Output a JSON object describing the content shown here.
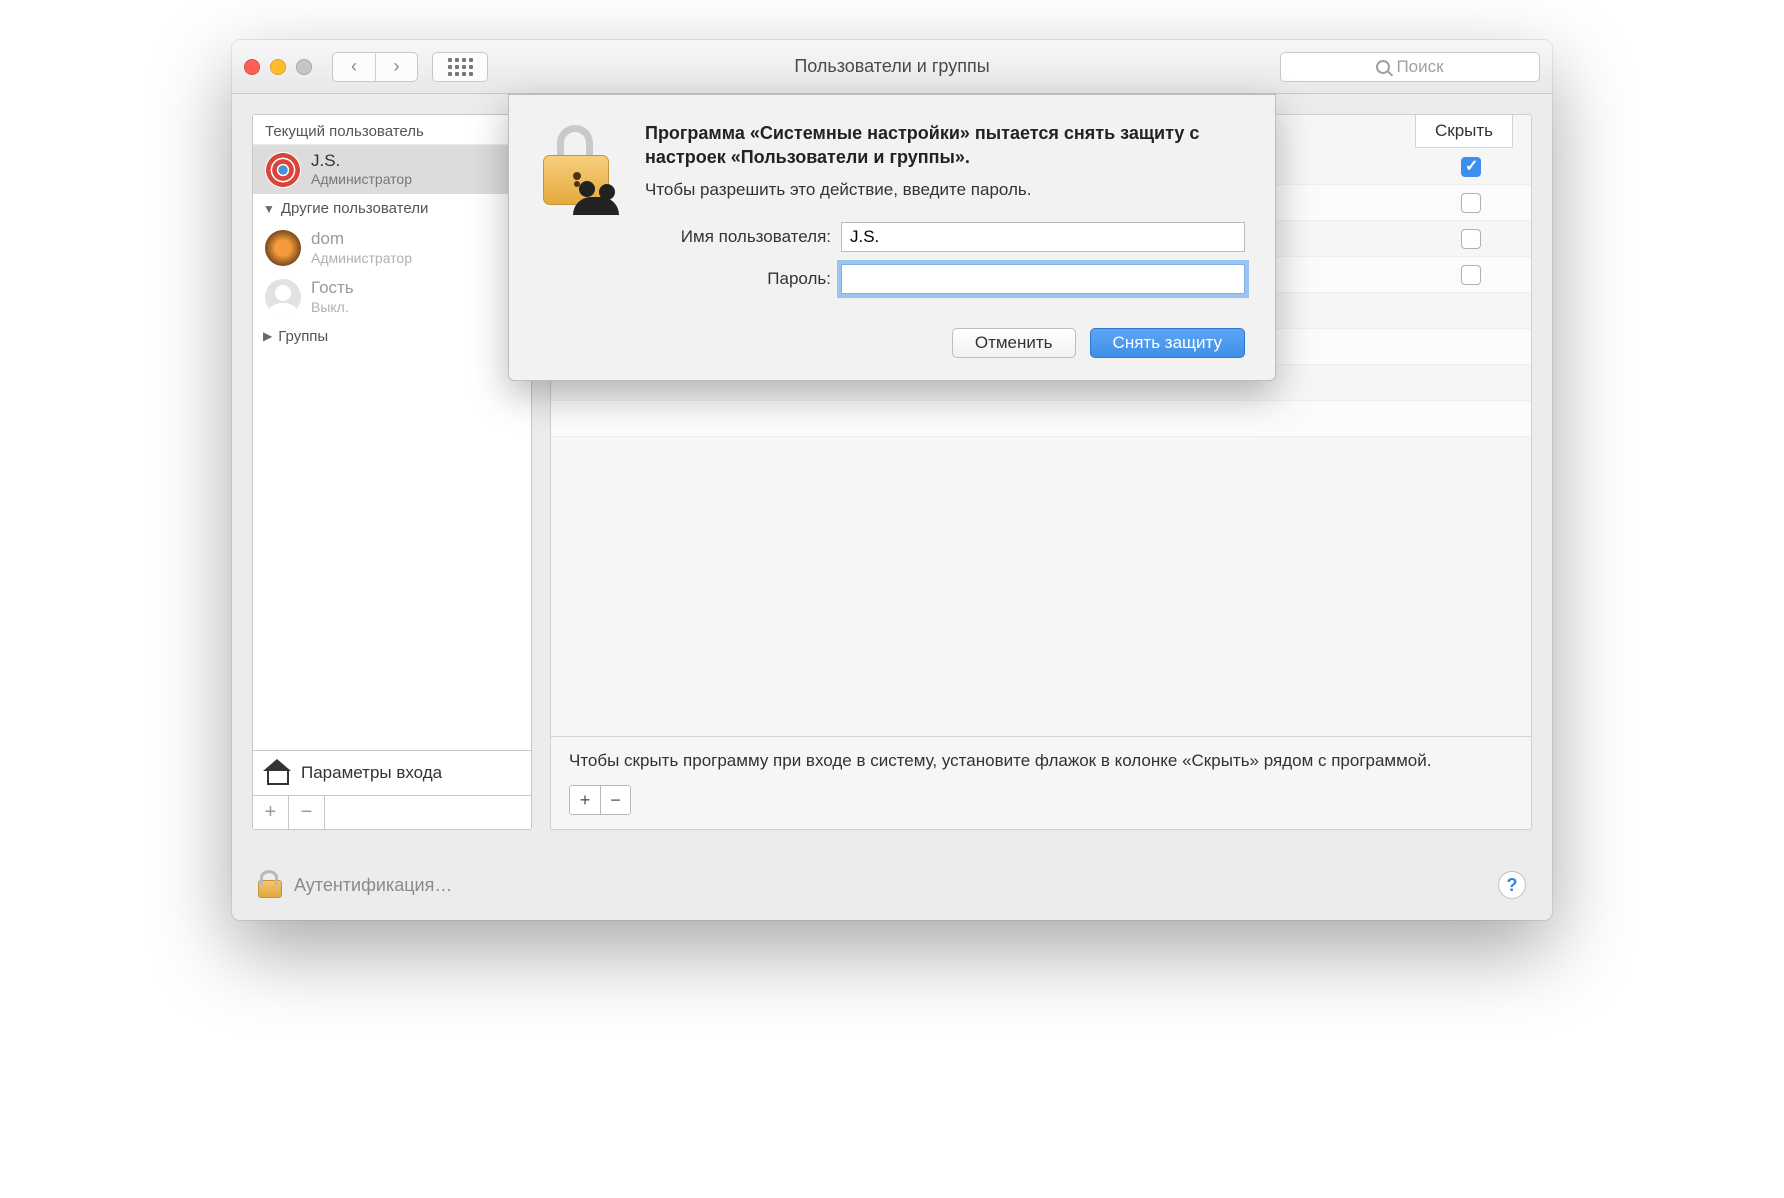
{
  "window": {
    "title": "Пользователи и группы",
    "search_placeholder": "Поиск"
  },
  "sidebar": {
    "current_user_label": "Текущий пользователь",
    "other_users_label": "Другие пользователи",
    "groups_label": "Группы",
    "login_options_label": "Параметры входа",
    "users": [
      {
        "name": "J.S.",
        "role": "Администратор",
        "selected": true
      },
      {
        "name": "dom",
        "role": "Администратор"
      },
      {
        "name": "Гость",
        "role": "Выкл."
      }
    ]
  },
  "main": {
    "hide_column": "Скрыть",
    "rows": [
      {
        "checked": true
      },
      {
        "checked": false
      },
      {
        "checked": false
      },
      {
        "checked": false
      }
    ],
    "hint": "Чтобы скрыть программу при входе в систему, установите флажок в колонке «Скрыть» рядом с программой."
  },
  "footer": {
    "auth_text": "Аутентификация…"
  },
  "dialog": {
    "title": "Программа «Системные настройки» пытается снять защиту с настроек «Пользователи и группы».",
    "subtitle": "Чтобы разрешить это действие, введите пароль.",
    "username_label": "Имя пользователя:",
    "password_label": "Пароль:",
    "username_value": "J.S.",
    "password_value": "",
    "cancel": "Отменить",
    "unlock": "Снять защиту"
  }
}
